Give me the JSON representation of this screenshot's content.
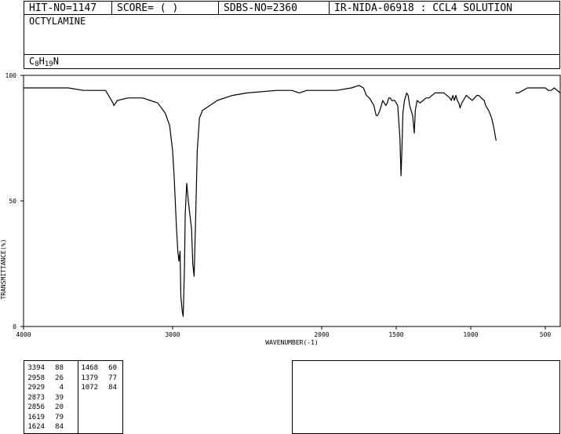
{
  "header": {
    "hit_no": "HIT-NO=1147",
    "score": "SCORE=  (  )",
    "sdbs_no": "SDBS-NO=2360",
    "ir_info": "IR-NIDA-06918 : CCL4 SOLUTION"
  },
  "compound": {
    "name": "OCTYLAMINE",
    "formula_parts": [
      {
        "t": "C",
        "sub": false
      },
      {
        "t": "8",
        "sub": true
      },
      {
        "t": "H",
        "sub": false
      },
      {
        "t": "19",
        "sub": true
      },
      {
        "t": "N",
        "sub": false
      }
    ]
  },
  "chart_data": {
    "type": "line",
    "xlabel": "WAVENUMBER(-1)",
    "ylabel": "TRANSMITTANCE(%)",
    "xlim": [
      4000,
      400
    ],
    "ylim": [
      0,
      100
    ],
    "x_ticks": [
      4000,
      3000,
      2000,
      1500,
      1000,
      500
    ],
    "y_ticks": [
      0,
      50,
      100
    ],
    "grid": false,
    "color": "#000000",
    "segments": [
      [
        [
          4000,
          95
        ],
        [
          3700,
          95
        ],
        [
          3600,
          94
        ],
        [
          3450,
          94
        ],
        [
          3400,
          89
        ],
        [
          3394,
          88
        ],
        [
          3370,
          90
        ],
        [
          3300,
          91
        ],
        [
          3200,
          91
        ],
        [
          3150,
          90
        ],
        [
          3100,
          89
        ],
        [
          3050,
          85
        ],
        [
          3020,
          80
        ],
        [
          3000,
          70
        ],
        [
          2990,
          60
        ],
        [
          2975,
          40
        ],
        [
          2965,
          30
        ],
        [
          2958,
          26
        ],
        [
          2950,
          30
        ],
        [
          2945,
          12
        ],
        [
          2935,
          6
        ],
        [
          2929,
          4
        ],
        [
          2920,
          25
        ],
        [
          2915,
          45
        ],
        [
          2905,
          57
        ],
        [
          2895,
          50
        ],
        [
          2885,
          45
        ],
        [
          2873,
          39
        ],
        [
          2865,
          25
        ],
        [
          2856,
          20
        ],
        [
          2845,
          45
        ],
        [
          2835,
          70
        ],
        [
          2820,
          83
        ],
        [
          2800,
          86
        ],
        [
          2750,
          88
        ],
        [
          2700,
          90
        ],
        [
          2600,
          92
        ],
        [
          2500,
          93
        ],
        [
          2300,
          94
        ],
        [
          2200,
          94
        ],
        [
          2150,
          93
        ],
        [
          2100,
          94
        ],
        [
          2000,
          94
        ],
        [
          1900,
          94
        ],
        [
          1800,
          95
        ],
        [
          1750,
          96
        ],
        [
          1720,
          95
        ],
        [
          1700,
          92
        ],
        [
          1680,
          91
        ],
        [
          1650,
          88
        ],
        [
          1635,
          84
        ],
        [
          1624,
          84
        ],
        [
          1610,
          86
        ],
        [
          1600,
          88
        ],
        [
          1590,
          90
        ],
        [
          1580,
          89
        ],
        [
          1570,
          88
        ],
        [
          1560,
          89
        ],
        [
          1550,
          91
        ],
        [
          1540,
          91
        ],
        [
          1530,
          90
        ],
        [
          1510,
          90
        ],
        [
          1490,
          88
        ],
        [
          1475,
          75
        ],
        [
          1468,
          60
        ],
        [
          1462,
          70
        ],
        [
          1455,
          85
        ],
        [
          1445,
          90
        ],
        [
          1430,
          93
        ],
        [
          1420,
          92
        ],
        [
          1410,
          88
        ],
        [
          1400,
          86
        ],
        [
          1390,
          84
        ],
        [
          1379,
          77
        ],
        [
          1372,
          86
        ],
        [
          1360,
          90
        ],
        [
          1340,
          89
        ],
        [
          1320,
          90
        ],
        [
          1300,
          91
        ],
        [
          1280,
          91
        ],
        [
          1260,
          92
        ],
        [
          1240,
          93
        ],
        [
          1220,
          93
        ],
        [
          1200,
          93
        ],
        [
          1180,
          93
        ],
        [
          1160,
          92
        ],
        [
          1140,
          91
        ],
        [
          1130,
          90
        ],
        [
          1120,
          92
        ],
        [
          1110,
          90
        ],
        [
          1100,
          92
        ],
        [
          1090,
          90
        ],
        [
          1080,
          89
        ],
        [
          1072,
          87
        ],
        [
          1060,
          89
        ],
        [
          1050,
          90
        ],
        [
          1040,
          91
        ],
        [
          1030,
          92
        ],
        [
          1010,
          91
        ],
        [
          990,
          90
        ],
        [
          975,
          91
        ],
        [
          960,
          92
        ],
        [
          945,
          92
        ],
        [
          930,
          91
        ],
        [
          910,
          90
        ],
        [
          900,
          88
        ],
        [
          880,
          86
        ],
        [
          860,
          83
        ],
        [
          845,
          79
        ],
        [
          830,
          74
        ]
      ],
      [
        [
          700,
          93
        ],
        [
          680,
          93
        ],
        [
          650,
          94
        ],
        [
          620,
          95
        ],
        [
          560,
          95
        ],
        [
          500,
          95
        ],
        [
          480,
          94
        ],
        [
          460,
          94
        ],
        [
          440,
          95
        ],
        [
          420,
          94
        ],
        [
          400,
          93
        ]
      ]
    ]
  },
  "peaks": [
    {
      "wn": "3394",
      "t": "88"
    },
    {
      "wn": "2958",
      "t": "26"
    },
    {
      "wn": "2929",
      "t": "4"
    },
    {
      "wn": "2873",
      "t": "39"
    },
    {
      "wn": "2856",
      "t": "20"
    },
    {
      "wn": "1619",
      "t": "79"
    },
    {
      "wn": "1624",
      "t": "84"
    },
    {
      "wn": "1468",
      "t": "60"
    },
    {
      "wn": "1379",
      "t": "77"
    },
    {
      "wn": "1072",
      "t": "84"
    }
  ]
}
